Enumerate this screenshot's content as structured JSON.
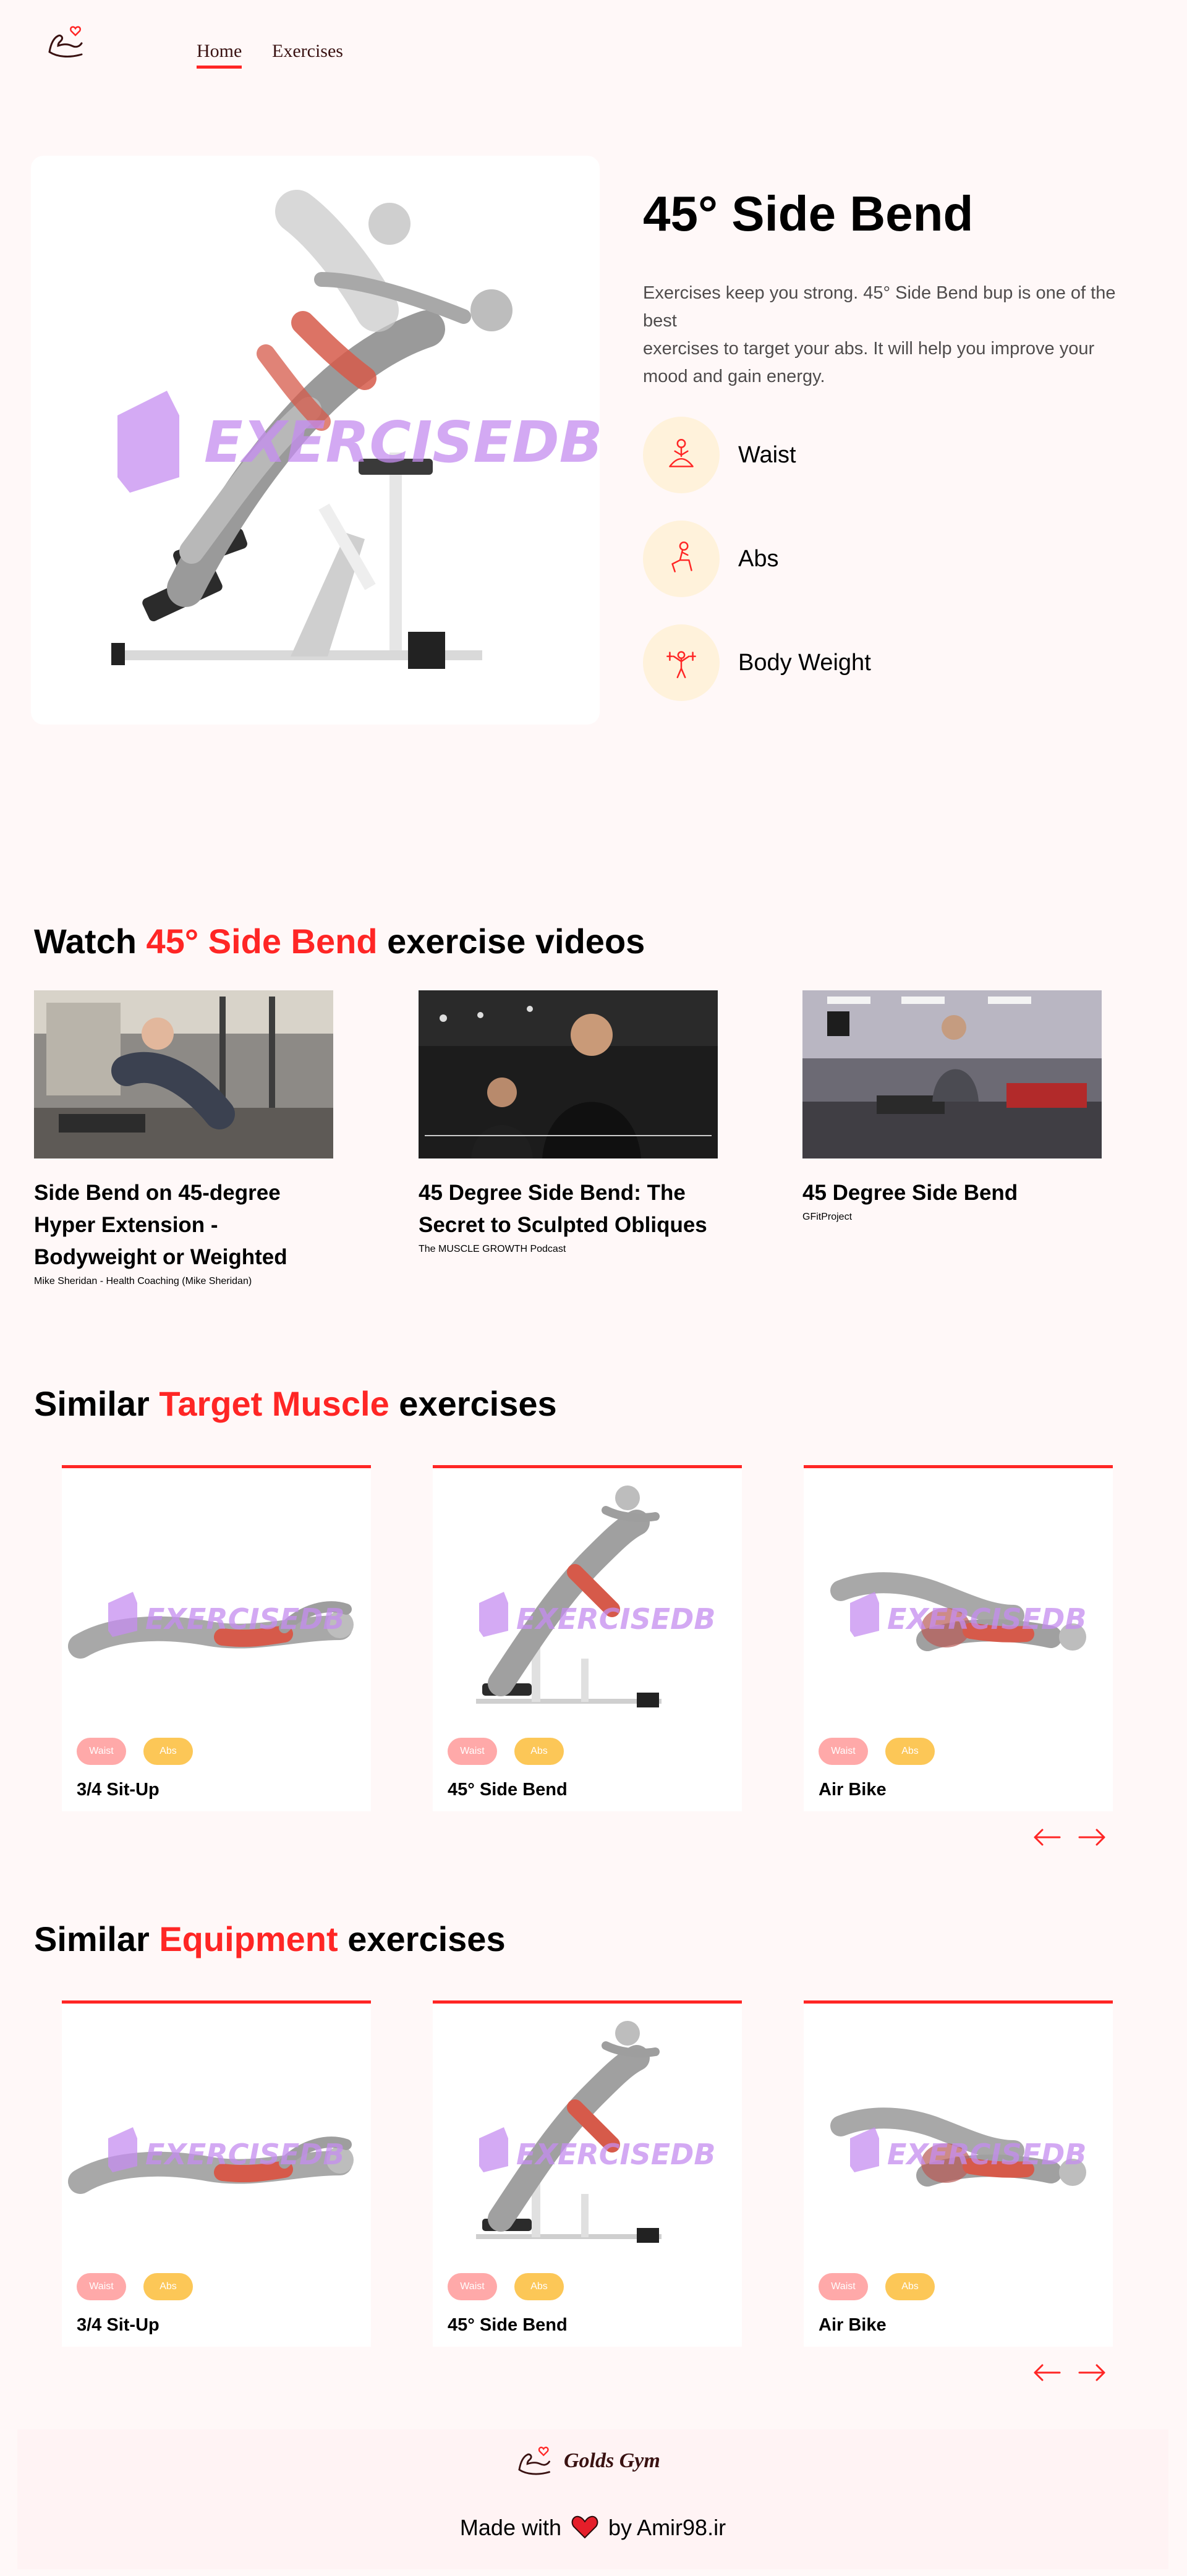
{
  "nav": {
    "logo": "gym-logo-icon",
    "links": [
      {
        "label": "Home",
        "active": true
      },
      {
        "label": "Exercises",
        "active": false
      }
    ]
  },
  "detail": {
    "image_watermark": "EXERCISEDB",
    "title": "45° Side Bend",
    "description_lines": [
      "Exercises keep you strong. 45° Side Bend bup is one of the best",
      "exercises to target your abs. It will help you improve your mood and gain energy."
    ],
    "extras": [
      {
        "icon": "body-part-icon",
        "label": "Waist"
      },
      {
        "icon": "target-icon",
        "label": "Abs"
      },
      {
        "icon": "equipment-icon",
        "label": "Body Weight"
      }
    ]
  },
  "videos_section": {
    "title_prefix": "Watch",
    "title_accent": "45° Side Bend",
    "title_suffix": "exercise videos",
    "videos": [
      {
        "title": "Side Bend on 45-degree Hyper Extension - Bodyweight or Weighted",
        "channel": "Mike Sheridan - Health Coaching (Mike Sheridan)"
      },
      {
        "title": "45 Degree Side Bend: The Secret to Sculpted Obliques",
        "channel": "The MUSCLE GROWTH Podcast"
      },
      {
        "title": "45 Degree Side Bend",
        "channel": "GFitProject"
      }
    ]
  },
  "similar_target": {
    "title_prefix": "Similar",
    "title_accent": "Target Muscle",
    "title_suffix": "exercises",
    "cards": [
      {
        "name": "3/4 Sit-Up",
        "tags": [
          "Waist",
          "Abs"
        ],
        "watermark": "EXERCISEDB"
      },
      {
        "name": "45° Side Bend",
        "tags": [
          "Waist",
          "Abs"
        ],
        "watermark": "EXERCISEDB"
      },
      {
        "name": "Air Bike",
        "tags": [
          "Waist",
          "Abs"
        ],
        "watermark": "EXERCISEDB"
      }
    ]
  },
  "similar_equipment": {
    "title_prefix": "Similar",
    "title_accent": "Equipment",
    "title_suffix": "exercises",
    "cards": [
      {
        "name": "3/4 Sit-Up",
        "tags": [
          "Waist",
          "Abs"
        ],
        "watermark": "EXERCISEDB"
      },
      {
        "name": "45° Side Bend",
        "tags": [
          "Waist",
          "Abs"
        ],
        "watermark": "EXERCISEDB"
      },
      {
        "name": "Air Bike",
        "tags": [
          "Waist",
          "Abs"
        ],
        "watermark": "EXERCISEDB"
      }
    ]
  },
  "footer": {
    "brand": "Golds Gym",
    "made_prefix": "Made with",
    "made_suffix": "by Amir98.ir"
  },
  "colors": {
    "accent": "#ff2625",
    "background": "#fff8f8",
    "pill_waist": "#ffa9a9",
    "pill_abs": "#fcc757",
    "icon_circle": "#fff2db",
    "watermark": "#c58df0"
  }
}
